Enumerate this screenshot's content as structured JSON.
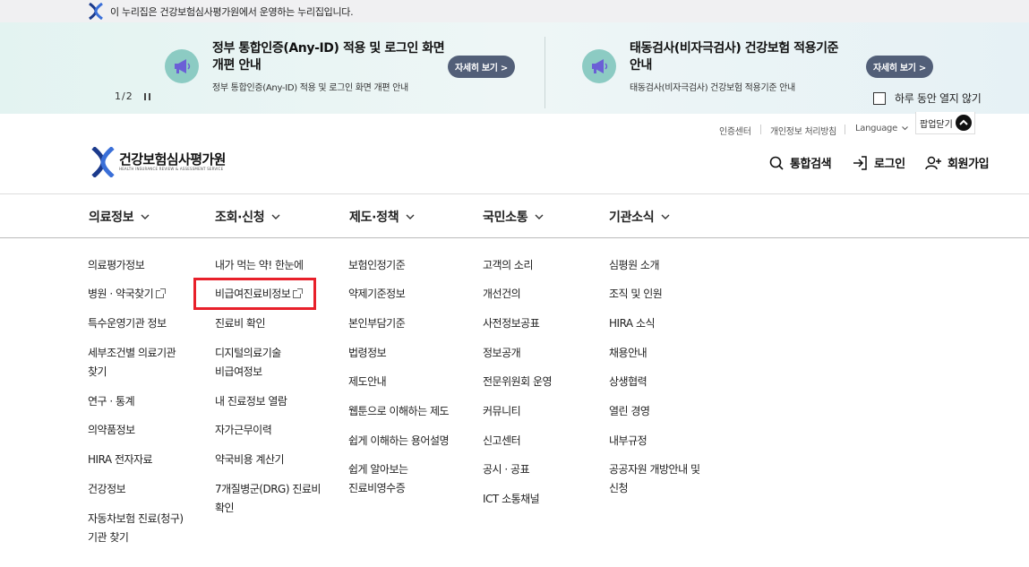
{
  "gov_banner": {
    "text": "이 누리집은 건강보험심사평가원에서 운영하는 누리집입니다."
  },
  "popup": {
    "notices": [
      {
        "title_line1": "정부 통합인증(Any-ID) 적용 및 로그인 화면",
        "title_line2": "개편 안내",
        "subtitle": "정부 통합인증(Any-ID) 적용 및 로그인 화면 개편 안내",
        "button": "자세히 보기 >"
      },
      {
        "title_line1": "태동검사(비자극검사) 건강보험 적용기준",
        "title_line2": "안내",
        "subtitle": "태동검사(비자극검사) 건강보험 적용기준 안내",
        "button": "자세히 보기 >"
      }
    ],
    "pager": "1/2",
    "dont_show_today": "하루 동안 열지 않기",
    "close_label": "팝업닫기"
  },
  "util_links": {
    "cert": "인증센터",
    "privacy": "개인정보 처리방침",
    "language": "Language"
  },
  "header": {
    "logo_text": "건강보험심사평가원",
    "logo_sub": "HEALTH INSURANCE REVIEW & ASSESSMENT SERVICE",
    "search": "통합검색",
    "login": "로그인",
    "join": "회원가입"
  },
  "gnb": [
    "의료정보",
    "조회·신청",
    "제도·정책",
    "국민소통",
    "기관소식"
  ],
  "menu": {
    "col1": [
      "의료평가정보",
      "병원 · 약국찾기",
      "특수운영기관 정보",
      "세부조건별 의료기관",
      "찾기",
      "연구 · 통계",
      "의약품정보",
      "HIRA 전자자료",
      "건강정보",
      "자동차보험 진료(청구)",
      "기관 찾기"
    ],
    "col2": [
      "내가 먹는 약! 한눈에",
      "비급여진료비정보",
      "진료비 확인",
      "디지털의료기술",
      "비급여정보",
      "내 진료정보 열람",
      "자가근무이력",
      "약국비용 계산기",
      "7개질병군(DRG) 진료비",
      "확인"
    ],
    "col3": [
      "보험인정기준",
      "약제기준정보",
      "본인부담기준",
      "법령정보",
      "제도안내",
      "웹툰으로 이해하는 제도",
      "쉽게 이해하는 용어설명",
      "쉽게 알아보는",
      "진료비영수증"
    ],
    "col4": [
      "고객의 소리",
      "개선건의",
      "사전정보공표",
      "정보공개",
      "전문위원회 운영",
      "커뮤니티",
      "신고센터",
      "공시 · 공표",
      "ICT 소통채널"
    ],
    "col5": [
      "심평원 소개",
      "조직 및 인원",
      "HIRA 소식",
      "채용안내",
      "상생협력",
      "열린 경영",
      "내부규정",
      "공공자원 개방안내 및",
      "신청"
    ]
  }
}
